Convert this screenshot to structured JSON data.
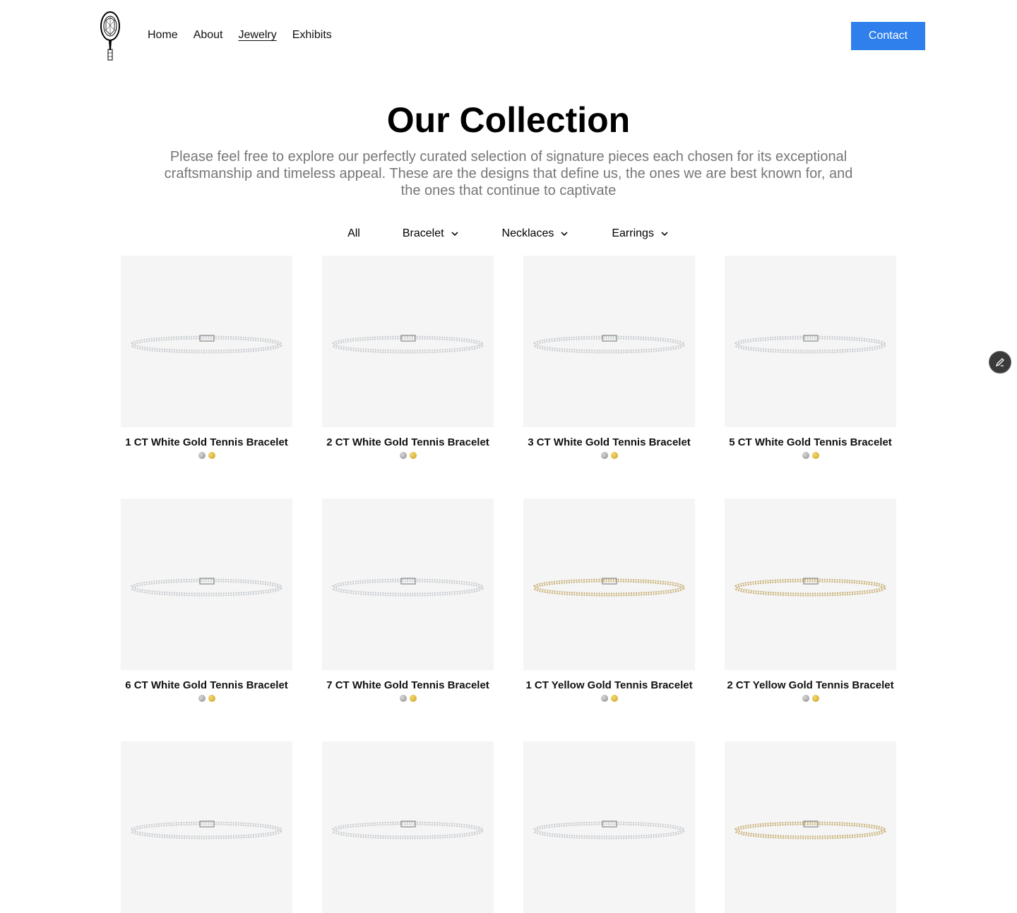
{
  "nav": {
    "logo_icon": "tennis-racket-diamond-logo",
    "links": [
      {
        "label": "Home",
        "active": false
      },
      {
        "label": "About",
        "active": false
      },
      {
        "label": "Jewelry",
        "active": true
      },
      {
        "label": "Exhibits",
        "active": false
      }
    ],
    "contact_label": "Contact",
    "contact_color": "#2f80ed"
  },
  "header": {
    "title": "Our Collection",
    "subtitle": "Please feel free to explore our perfectly curated selection of signature pieces each chosen for its exceptional craftsmanship and timeless appeal. These are the designs that define us, the ones we are best known for, and the ones that continue to captivate"
  },
  "filters": [
    {
      "label": "All",
      "dropdown": false,
      "icon": ""
    },
    {
      "label": "Bracelet",
      "dropdown": true,
      "icon": "chevron-down-icon"
    },
    {
      "label": "Necklaces",
      "dropdown": true,
      "icon": "chevron-down-icon"
    },
    {
      "label": "Earrings",
      "dropdown": true,
      "icon": "chevron-down-icon"
    }
  ],
  "products": [
    {
      "name": "1 CT White Gold Tennis Bracelet",
      "metal": "white",
      "swatches": [
        "silver",
        "gold"
      ]
    },
    {
      "name": "2 CT White Gold Tennis Bracelet",
      "metal": "white",
      "swatches": [
        "silver",
        "gold"
      ]
    },
    {
      "name": "3 CT White Gold Tennis Bracelet",
      "metal": "white",
      "swatches": [
        "silver",
        "gold"
      ]
    },
    {
      "name": "5 CT White Gold Tennis Bracelet",
      "metal": "white",
      "swatches": [
        "silver",
        "gold"
      ]
    },
    {
      "name": "6 CT White Gold Tennis Bracelet",
      "metal": "white",
      "swatches": [
        "silver",
        "gold"
      ]
    },
    {
      "name": "7 CT White Gold Tennis Bracelet",
      "metal": "white",
      "swatches": [
        "silver",
        "gold"
      ]
    },
    {
      "name": "1 CT Yellow Gold Tennis Bracelet",
      "metal": "yellow",
      "swatches": [
        "silver",
        "gold"
      ]
    },
    {
      "name": "2 CT Yellow Gold Tennis Bracelet",
      "metal": "yellow",
      "swatches": [
        "silver",
        "gold"
      ]
    },
    {
      "name": "",
      "metal": "white",
      "swatches": []
    },
    {
      "name": "",
      "metal": "white",
      "swatches": []
    },
    {
      "name": "",
      "metal": "white",
      "swatches": []
    },
    {
      "name": "",
      "metal": "yellow",
      "swatches": []
    }
  ],
  "colors": {
    "image_background": "#f5f5f5",
    "white_gold": "#c8ccd0",
    "yellow_gold": "#c9b27a",
    "subtitle_text": "#777777"
  },
  "edit_fab_icon": "pencil-icon"
}
